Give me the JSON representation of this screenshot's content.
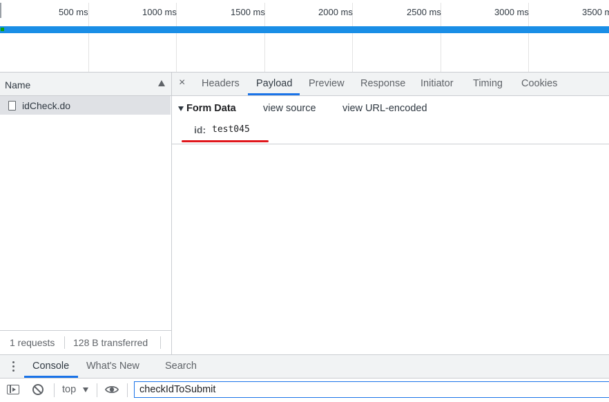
{
  "timeline": {
    "ticks": [
      "500 ms",
      "1000 ms",
      "1500 ms",
      "2000 ms",
      "2500 ms",
      "3000 ms",
      "3500 m"
    ]
  },
  "requests_panel": {
    "column_header": "Name",
    "rows": [
      {
        "name": "idCheck.do"
      }
    ],
    "status": {
      "requests": "1 requests",
      "transferred": "128 B transferred"
    }
  },
  "detail_panel": {
    "close_glyph": "×",
    "tabs": [
      {
        "label": "Headers",
        "active": false
      },
      {
        "label": "Payload",
        "active": true
      },
      {
        "label": "Preview",
        "active": false
      },
      {
        "label": "Response",
        "active": false
      },
      {
        "label": "Initiator",
        "active": false
      },
      {
        "label": "Timing",
        "active": false
      },
      {
        "label": "Cookies",
        "active": false
      }
    ],
    "payload": {
      "section_title": "Form Data",
      "view_source": "view source",
      "view_url_encoded": "view URL-encoded",
      "params": [
        {
          "key": "id:",
          "value": "test045"
        }
      ],
      "annotation_color": "#e0161b"
    }
  },
  "drawer": {
    "tabs": [
      {
        "label": "Console",
        "active": true
      },
      {
        "label": "What's New",
        "active": false
      },
      {
        "label": "Search",
        "active": false
      }
    ],
    "toolbar": {
      "context": "top",
      "filter_value": "checkIdToSubmit"
    }
  },
  "colors": {
    "accent": "#1a73e8",
    "timeline_bar": "#1a8ee6",
    "panel_bg": "#f1f3f4",
    "selected_row": "#dfe1e5"
  }
}
